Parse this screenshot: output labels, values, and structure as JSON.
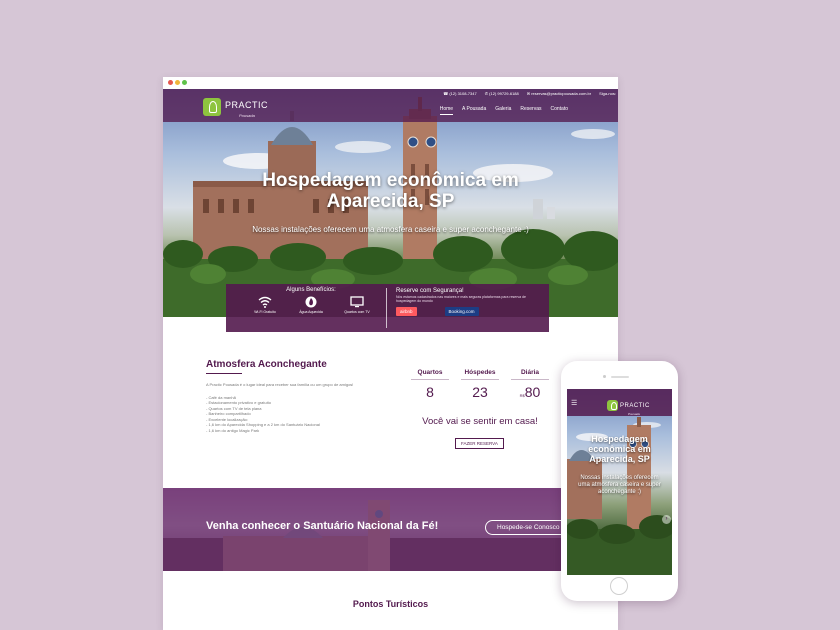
{
  "desktop": {
    "header": {
      "logo_name": "PRACTIC",
      "logo_sub": "Pousada",
      "phone1": "(12) 3108-7347",
      "phone2": "(12) 99729-6188",
      "email": "reservas@practicpousada.com.br",
      "social_label": "Siga-nos:",
      "nav": [
        "Home",
        "A Pousada",
        "Galeria",
        "Reservas",
        "Contato"
      ]
    },
    "hero": {
      "title_line1": "Hospedagem econômica em",
      "title_line2": "Aparecida, SP",
      "subtitle": "Nossas instalações oferecem uma atmosfera caseira e super aconchegante :)"
    },
    "benefits": {
      "title": "Alguns Benefícios:",
      "items": [
        "Wi-Fi Gratuito",
        "Água Aquecida",
        "Quartos com TV"
      ],
      "secure_title": "Reserve com Segurança!",
      "secure_text": "Nós estamos cadastrados nas maiores e mais seguras plataformas para reserva de hospedagem do mundo",
      "airbnb": "airbnb",
      "booking": "Booking.com"
    },
    "about": {
      "title": "Atmosfera Aconchegante",
      "text": "A Practic Pousada é o lugar ideal para receber sua família ou um grupo de amigos!",
      "list": [
        "- Café da manhã",
        "- Estacionamento privativo e gratuito",
        "- Quartos com TV de tela plana",
        "- Banheiro compartilhado",
        "- Excelente localização:",
        "- 1,6 km do Aparecida Shopping e a 2 km do Santuário Nacional",
        "- 1,6 km do antigo Magic Park"
      ]
    },
    "stats": {
      "quartos_label": "Quartos",
      "quartos_value": "8",
      "hospedes_label": "Hóspedes",
      "hospedes_value": "23",
      "diaria_label": "Diária",
      "diaria_currency": "R$",
      "diaria_value": "80",
      "tagline": "Você vai se sentir em casa!",
      "button": "FAZER RESERVA"
    },
    "banner": {
      "title": "Venha conhecer o Santuário Nacional da Fé!",
      "button": "Hospede-se Conosco"
    },
    "points_title": "Pontos Turísticos"
  },
  "mobile": {
    "logo_name": "PRACTIC",
    "logo_sub": "Pousada",
    "menu_icon": "☰",
    "title_line1": "Hospedagem",
    "title_line2": "econômica em",
    "title_line3": "Aparecida, SP",
    "subtitle": "Nossas instalações oferecem uma atmosfera caseira e super aconchegante :)"
  },
  "colors": {
    "brand": "#531a4e",
    "accent": "#8ec43f",
    "background": "#d6c6d6"
  }
}
